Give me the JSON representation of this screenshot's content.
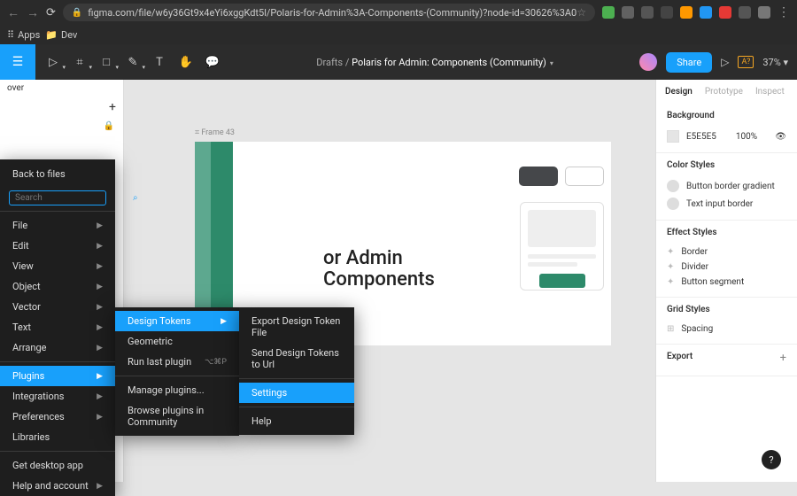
{
  "browser": {
    "url": "figma.com/file/w6y36Gt9x4eYi6xggKdt5l/Polaris-for-Admin%3A-Components-(Community)?node-id=30626%3A0",
    "bookmarks": {
      "apps": "Apps",
      "dev": "Dev"
    }
  },
  "toolbar": {
    "crumb_drafts": "Drafts",
    "crumb_project": "Polaris for Admin: Components (Community)",
    "share": "Share",
    "aq": "A?",
    "zoom": "37%"
  },
  "left_panel": {
    "cover": "over"
  },
  "canvas": {
    "frame_label": "Frame 43",
    "hero_line1": "or Admin",
    "hero_line2": "Components"
  },
  "right_panel": {
    "tabs": {
      "design": "Design",
      "prototype": "Prototype",
      "inspect": "Inspect"
    },
    "background": {
      "title": "Background",
      "hex": "E5E5E5",
      "opacity": "100%"
    },
    "color_styles": {
      "title": "Color Styles",
      "items": [
        "Button border gradient",
        "Text input border"
      ]
    },
    "effect_styles": {
      "title": "Effect Styles",
      "items": [
        "Border",
        "Divider",
        "Button segment"
      ]
    },
    "grid_styles": {
      "title": "Grid Styles",
      "items": [
        "Spacing"
      ]
    },
    "export": "Export"
  },
  "menu1": {
    "back": "Back to files",
    "search_ph": "Search",
    "items": [
      "File",
      "Edit",
      "View",
      "Object",
      "Vector",
      "Text",
      "Arrange"
    ],
    "plugins": "Plugins",
    "integrations": "Integrations",
    "preferences": "Preferences",
    "libraries": "Libraries",
    "desktop": "Get desktop app",
    "help": "Help and account"
  },
  "menu2": {
    "design_tokens": "Design Tokens",
    "geometric": "Geometric",
    "run_last": "Run last plugin",
    "shortcut": "⌥⌘P",
    "manage": "Manage plugins...",
    "browse": "Browse plugins in Community"
  },
  "menu3": {
    "export": "Export Design Token File",
    "send": "Send Design Tokens to Url",
    "settings": "Settings",
    "help": "Help"
  }
}
